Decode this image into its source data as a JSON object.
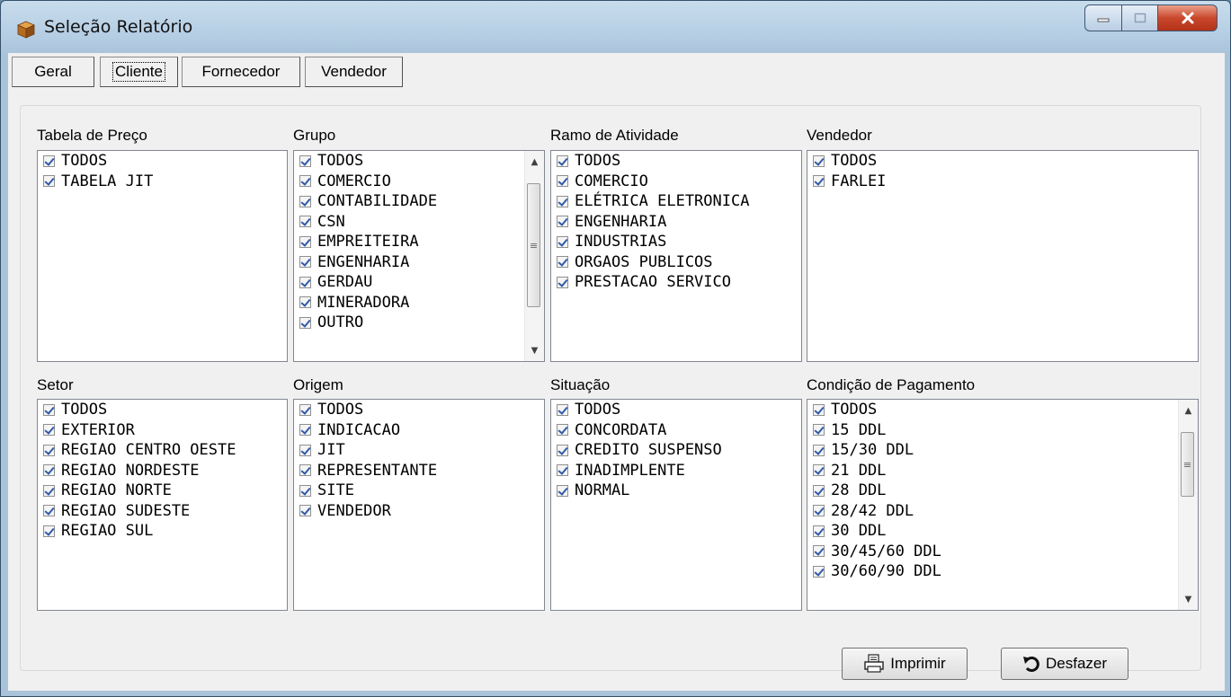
{
  "window": {
    "title": "Seleção Relatório"
  },
  "tabs": [
    {
      "label": "Geral"
    },
    {
      "label": "Cliente"
    },
    {
      "label": "Fornecedor"
    },
    {
      "label": "Vendedor"
    }
  ],
  "groups": {
    "tabela_preco": {
      "label": "Tabela de Preço",
      "items": [
        "TODOS",
        "TABELA JIT"
      ]
    },
    "grupo": {
      "label": "Grupo",
      "items": [
        "TODOS",
        "COMERCIO",
        "CONTABILIDADE",
        "CSN",
        "EMPREITEIRA",
        "ENGENHARIA",
        "GERDAU",
        "MINERADORA",
        "OUTRO"
      ]
    },
    "ramo": {
      "label": "Ramo de Atividade",
      "items": [
        "TODOS",
        "COMERCIO",
        "ELÉTRICA ELETRONICA",
        "ENGENHARIA",
        "INDUSTRIAS",
        "ORGAOS PUBLICOS",
        "PRESTACAO SERVICO"
      ]
    },
    "vendedor": {
      "label": "Vendedor",
      "items": [
        "TODOS",
        "FARLEI"
      ]
    },
    "setor": {
      "label": "Setor",
      "items": [
        "TODOS",
        "EXTERIOR",
        "REGIAO CENTRO OESTE",
        "REGIAO NORDESTE",
        "REGIAO NORTE",
        "REGIAO SUDESTE",
        "REGIAO SUL"
      ]
    },
    "origem": {
      "label": "Origem",
      "items": [
        "TODOS",
        "INDICACAO",
        "JIT",
        "REPRESENTANTE",
        "SITE",
        "VENDEDOR"
      ]
    },
    "situacao": {
      "label": "Situação",
      "items": [
        "TODOS",
        "CONCORDATA",
        "CREDITO SUSPENSO",
        "INADIMPLENTE",
        "NORMAL"
      ]
    },
    "condicao": {
      "label": "Condição de Pagamento",
      "items": [
        "TODOS",
        "15 DDL",
        "15/30 DDL",
        "21 DDL",
        "28 DDL",
        "28/42 DDL",
        "30 DDL",
        "30/45/60 DDL",
        "30/60/90 DDL"
      ]
    }
  },
  "buttons": {
    "print": "Imprimir",
    "undo": "Desfazer"
  },
  "colors": {
    "checkmark": "#2f5aa8",
    "close_button": "#c9482c"
  }
}
